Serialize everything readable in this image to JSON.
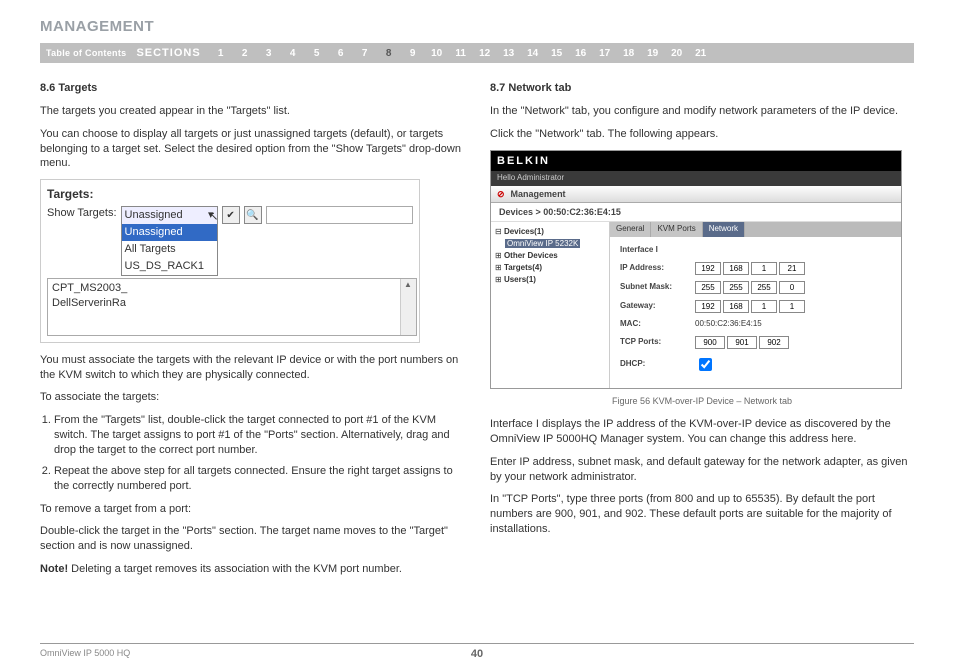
{
  "title": "MANAGEMENT",
  "nav": {
    "toc": "Table of Contents",
    "sections_label": "SECTIONS",
    "numbers": [
      "1",
      "2",
      "3",
      "4",
      "5",
      "6",
      "7",
      "8",
      "9",
      "10",
      "11",
      "12",
      "13",
      "14",
      "15",
      "16",
      "17",
      "18",
      "19",
      "20",
      "21"
    ],
    "current": "8"
  },
  "left": {
    "head": "8.6 Targets",
    "p1": "The targets you created appear in the \"Targets\" list.",
    "p2": "You can choose to display all targets or just unassigned targets (default), or targets belonging to a target set. Select the desired option from the \"Show Targets\" drop-down menu.",
    "shot": {
      "title": "Targets:",
      "show_label": "Show Targets:",
      "selected": "Unassigned",
      "opts": [
        "Unassigned",
        "All Targets",
        "US_DS_RACK1"
      ],
      "rows": [
        "CPT_MS2003_",
        "DellServerinRa"
      ]
    },
    "p3": "You must associate the targets with the relevant IP device or with the port numbers on the KVM switch to which they are physically connected.",
    "p4": "To associate the targets:",
    "li1": "From the \"Targets\" list, double-click the target connected to port #1 of the KVM switch. The target assigns to port #1 of the \"Ports\" section. Alternatively, drag and drop the target to the correct port number.",
    "li2": "Repeat the above step for all targets connected. Ensure the right target assigns to the correctly numbered port.",
    "p5": "To remove a target from a port:",
    "p6": "Double-click the target in the \"Ports\" section. The target name moves to the \"Target\" section and is now unassigned.",
    "note_label": "Note!",
    "note_text": " Deleting a target removes its association with the KVM port number."
  },
  "right": {
    "head": "8.7 Network tab",
    "p1": "In the \"Network\" tab, you configure and modify network parameters of the IP device.",
    "p2": "Click the \"Network\" tab. The following appears.",
    "fig": {
      "brand": "BELKIN",
      "hello": "Hello Administrator",
      "management": "Management",
      "breadcrumb_label": "Devices",
      "breadcrumb_sep": " > ",
      "breadcrumb_val": "00:50:C2:36:E4:15",
      "tree": {
        "devices": "Devices(1)",
        "device_sel": "OmniView IP 5232K",
        "other": "Other Devices",
        "targets": "Targets(4)",
        "users": "Users(1)"
      },
      "tabs": {
        "general": "General",
        "kvm": "KVM Ports",
        "network": "Network"
      },
      "form": {
        "iface": "Interface I",
        "ip_label": "IP Address:",
        "ip": [
          "192",
          "168",
          "1",
          "21"
        ],
        "subnet_label": "Subnet Mask:",
        "subnet": [
          "255",
          "255",
          "255",
          "0"
        ],
        "gw_label": "Gateway:",
        "gw": [
          "192",
          "168",
          "1",
          "1"
        ],
        "mac_label": "MAC:",
        "mac": "00:50:C2:36:E4:15",
        "tcp_label": "TCP Ports:",
        "tcp": [
          "900",
          "901",
          "902"
        ],
        "dhcp_label": "DHCP:"
      }
    },
    "caption": "Figure 56 KVM-over-IP Device – Network tab",
    "p3": "Interface I displays the IP address of the KVM-over-IP device as discovered by the OmniView IP 5000HQ Manager system. You can change this address here.",
    "p4": "Enter IP address, subnet mask, and default gateway for the network adapter, as given by your network administrator.",
    "p5": "In \"TCP Ports\", type three ports (from 800 and up to 65535). By default the port numbers are 900, 901, and 902. These default ports are suitable for the majority of installations."
  },
  "footer": {
    "product": "OmniView IP 5000 HQ",
    "page": "40"
  }
}
